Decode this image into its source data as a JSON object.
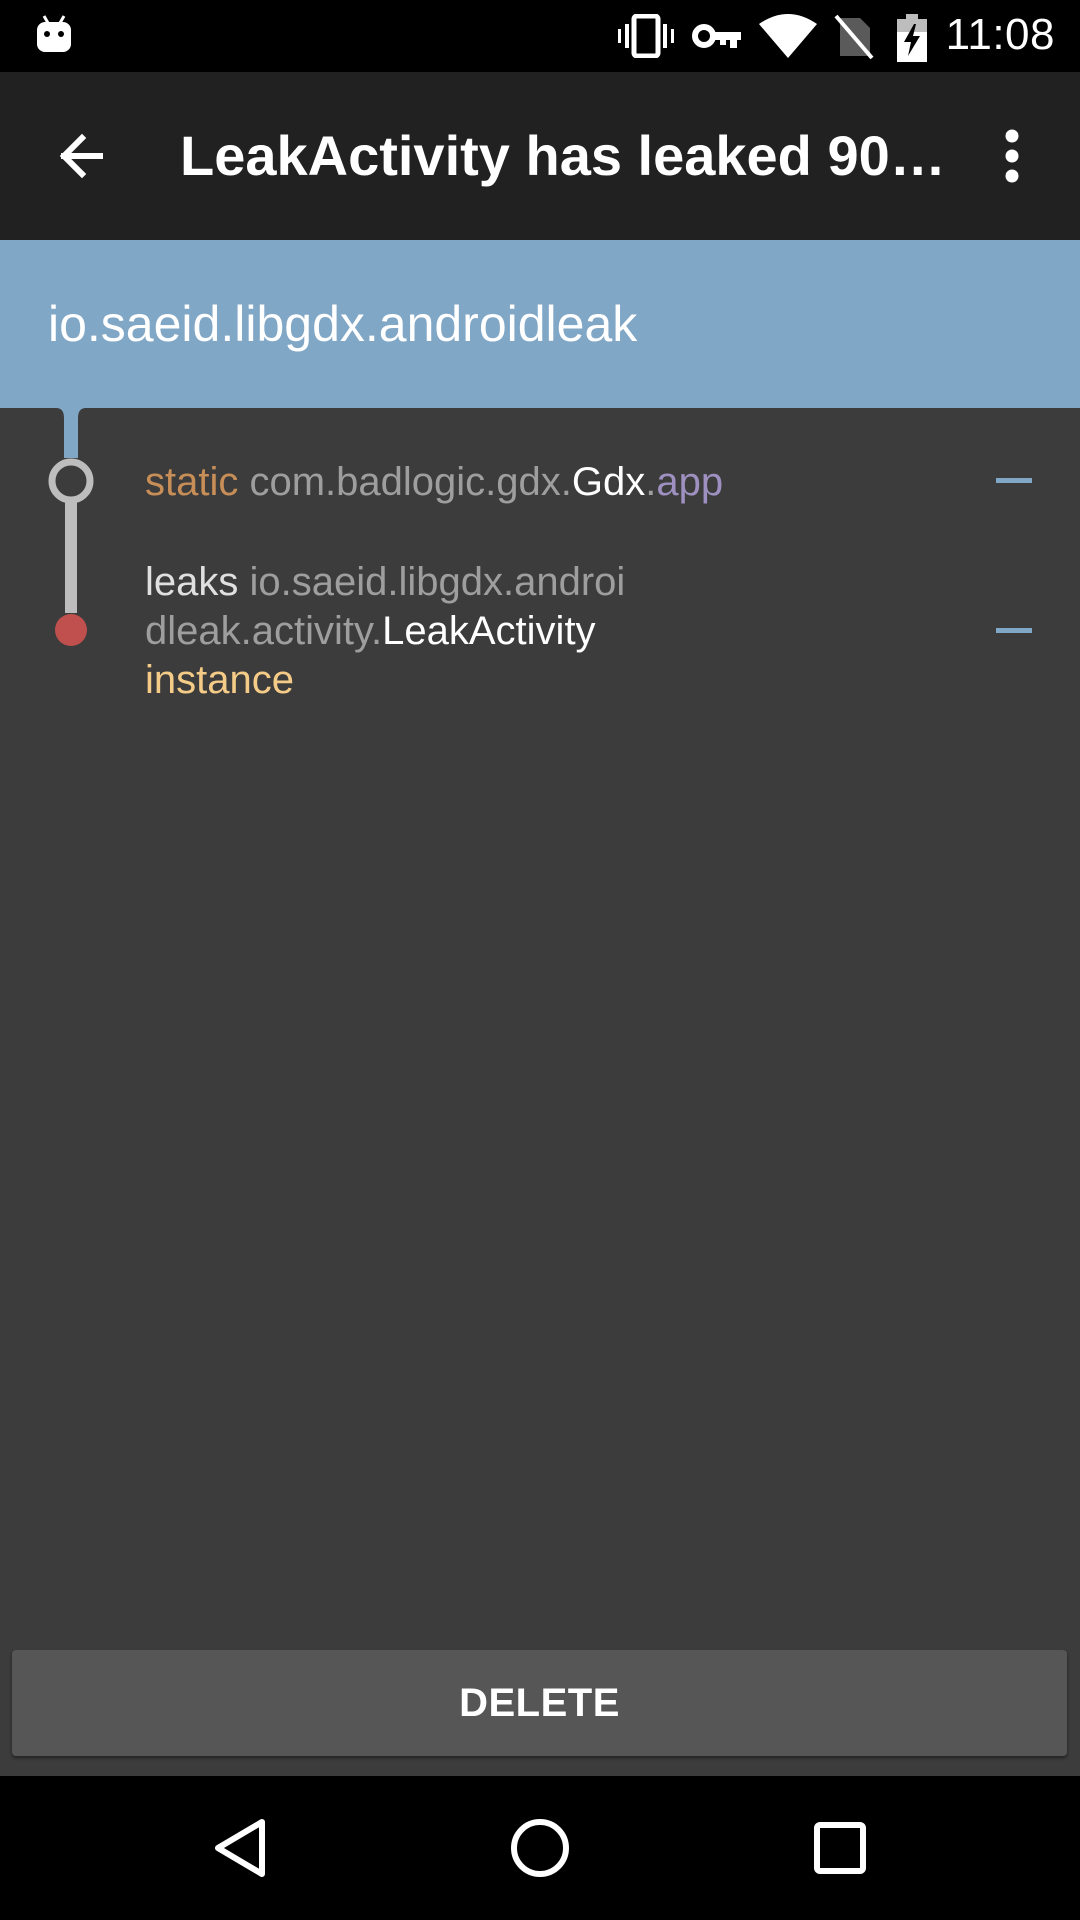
{
  "status_bar": {
    "time": "11:08",
    "icons": [
      "android-notification-icon",
      "vibrate-icon",
      "vpn-key-icon",
      "wifi-icon",
      "no-sim-icon",
      "battery-charging-icon"
    ]
  },
  "app_bar": {
    "title": "LeakActivity has leaked 90…",
    "back_icon": "arrow-back-icon",
    "menu_icon": "more-vert-icon"
  },
  "header": {
    "package_name": "io.saeid.libgdx.androidleak"
  },
  "trace": [
    {
      "parts": [
        {
          "text": "static ",
          "color": "#c88e57"
        },
        {
          "text": "com.badlogic.gdx.",
          "color": "#9e9e9e"
        },
        {
          "text": "Gdx",
          "color": "#ffffff"
        },
        {
          "text": ".",
          "color": "#9e9e9e"
        },
        {
          "text": "app",
          "color": "#9e90c0"
        }
      ]
    },
    {
      "lines": [
        [
          {
            "text": "leaks ",
            "color": "#e0e0e0"
          },
          {
            "text": "io.saeid.libgdx.androi",
            "color": "#9e9e9e"
          }
        ],
        [
          {
            "text": "dleak.activity.",
            "color": "#9e9e9e"
          },
          {
            "text": "LeakActivity",
            "color": "#ffffff"
          }
        ],
        [
          {
            "text": "instance",
            "color": "#f5cc87"
          }
        ]
      ]
    }
  ],
  "actions": {
    "delete_label": "DELETE"
  },
  "colors": {
    "accent": "#81a7c7",
    "leak_dot": "#c0504d",
    "background": "#3c3c3c",
    "app_bar": "#212121"
  },
  "nav_bar": {
    "icons": [
      "back-triangle-icon",
      "home-circle-icon",
      "recents-square-icon"
    ]
  }
}
